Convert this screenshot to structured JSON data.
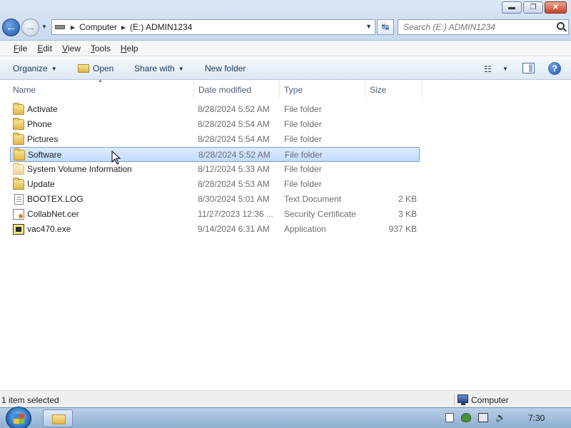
{
  "window": {
    "buttons": {
      "minimize": "▬",
      "maximize": "❐",
      "close": "✕"
    }
  },
  "nav": {
    "back_label": "←",
    "forward_label": "→",
    "address_parts": [
      "Computer",
      "(E:) ADMIN1234"
    ],
    "search_placeholder": "Search (E:) ADMIN1234"
  },
  "menu": {
    "items": [
      {
        "first": "F",
        "rest": "ile"
      },
      {
        "first": "E",
        "rest": "dit"
      },
      {
        "first": "V",
        "rest": "iew"
      },
      {
        "first": "T",
        "rest": "ools"
      },
      {
        "first": "H",
        "rest": "elp"
      }
    ]
  },
  "toolbar": {
    "organize": "Organize",
    "open": "Open",
    "share_with": "Share with",
    "new_folder": "New folder",
    "help": "?"
  },
  "columns": {
    "name": "Name",
    "date_modified": "Date modified",
    "type": "Type",
    "size": "Size"
  },
  "files": [
    {
      "name": "Activate",
      "date": "8/28/2024 5:52 AM",
      "type": "File folder",
      "size": "",
      "icon": "folder-icon",
      "selected": false
    },
    {
      "name": "Phone",
      "date": "8/28/2024 5:54 AM",
      "type": "File folder",
      "size": "",
      "icon": "folder-icon",
      "selected": false
    },
    {
      "name": "Pictures",
      "date": "8/28/2024 5:54 AM",
      "type": "File folder",
      "size": "",
      "icon": "folder-icon",
      "selected": false
    },
    {
      "name": "Software",
      "date": "8/28/2024 5:52 AM",
      "type": "File folder",
      "size": "",
      "icon": "folder-icon",
      "selected": true
    },
    {
      "name": "System Volume Information",
      "date": "8/12/2024 5:33 AM",
      "type": "File folder",
      "size": "",
      "icon": "folder-icon-faint",
      "selected": false
    },
    {
      "name": "Update",
      "date": "8/28/2024 5:53 AM",
      "type": "File folder",
      "size": "",
      "icon": "folder-icon",
      "selected": false
    },
    {
      "name": "BOOTEX.LOG",
      "date": "8/30/2024 5:01 AM",
      "type": "Text Document",
      "size": "2 KB",
      "icon": "document-icon",
      "selected": false
    },
    {
      "name": "CollabNet.cer",
      "date": "11/27/2023 12:36 ...",
      "type": "Security Certificate",
      "size": "3 KB",
      "icon": "certificate-icon",
      "selected": false
    },
    {
      "name": "vac470.exe",
      "date": "9/14/2024 6:31 AM",
      "type": "Application",
      "size": "937 KB",
      "icon": "application-icon",
      "selected": false
    }
  ],
  "status": {
    "selection": "1 item selected",
    "location": "Computer"
  },
  "taskbar": {
    "clock": "7:30"
  }
}
